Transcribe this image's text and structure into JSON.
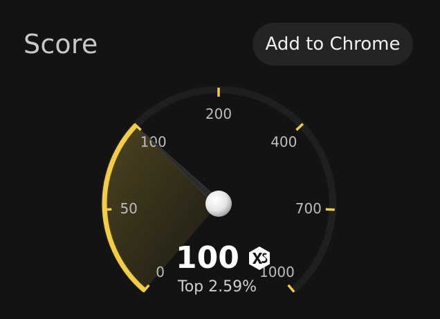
{
  "header": {
    "title": "Score",
    "add_button_label": "Add to Chrome"
  },
  "gauge": {
    "ticks": [
      "0",
      "50",
      "100",
      "200",
      "400",
      "700",
      "1000"
    ],
    "value": 100,
    "value_label": "100",
    "grade_icon": "xs-grade-icon",
    "rank_label": "Top 2.59%"
  },
  "colors": {
    "background": "#131313",
    "accent": "#f2cd45",
    "track": "#1f1f1f",
    "button_bg": "#242424"
  }
}
